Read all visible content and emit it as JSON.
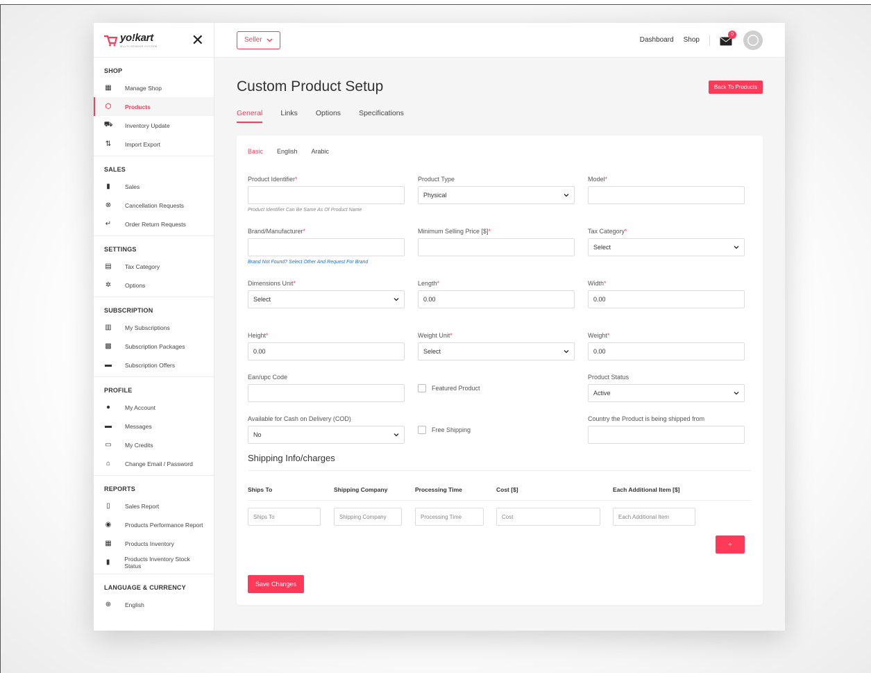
{
  "brand": {
    "name": "yo!kart",
    "tagline": "MULTI-VENDOR SYSTEM"
  },
  "sidebar": {
    "sections": [
      {
        "title": "SHOP",
        "items": [
          {
            "label": "Manage Shop",
            "icon": "shop-icon"
          },
          {
            "label": "Products",
            "icon": "box-icon",
            "active": true
          },
          {
            "label": "Inventory Update",
            "icon": "inventory-icon"
          },
          {
            "label": "Import Export",
            "icon": "import-export-icon"
          }
        ]
      },
      {
        "title": "SALES",
        "items": [
          {
            "label": "Sales",
            "icon": "bar-chart-icon"
          },
          {
            "label": "Cancellation Requests",
            "icon": "cancel-icon"
          },
          {
            "label": "Order Return Requests",
            "icon": "return-icon"
          }
        ]
      },
      {
        "title": "SETTINGS",
        "items": [
          {
            "label": "Tax Category",
            "icon": "tax-icon"
          },
          {
            "label": "Options",
            "icon": "gear-icon"
          }
        ]
      },
      {
        "title": "SUBSCRIPTION",
        "items": [
          {
            "label": "My Subscriptions",
            "icon": "subscription-icon"
          },
          {
            "label": "Subscription Packages",
            "icon": "packages-icon"
          },
          {
            "label": "Subscription Offers",
            "icon": "offers-icon"
          }
        ]
      },
      {
        "title": "PROFILE",
        "items": [
          {
            "label": "My Account",
            "icon": "account-icon"
          },
          {
            "label": "Messages",
            "icon": "message-icon"
          },
          {
            "label": "My Credits",
            "icon": "credits-icon"
          },
          {
            "label": "Change Email / Password",
            "icon": "lock-icon"
          }
        ]
      },
      {
        "title": "REPORTS",
        "items": [
          {
            "label": "Sales Report",
            "icon": "report-icon"
          },
          {
            "label": "Products Performance Report",
            "icon": "performance-icon"
          },
          {
            "label": "Products Inventory",
            "icon": "products-inventory-icon"
          },
          {
            "label": "Products Inventory Stock Status",
            "icon": "stock-status-icon"
          }
        ]
      },
      {
        "title": "LANGUAGE & CURRENCY",
        "items": [
          {
            "label": "English",
            "icon": "globe-icon"
          }
        ]
      }
    ]
  },
  "topbar": {
    "seller_label": "Seller",
    "dashboard_label": "Dashboard",
    "shop_label": "Shop",
    "mail_badge": "0"
  },
  "page": {
    "title": "Custom Product Setup",
    "back_button": "Back To Products",
    "tabs": [
      "General",
      "Links",
      "Options",
      "Specifications"
    ],
    "subtabs": [
      "Basic",
      "English",
      "Arabic"
    ]
  },
  "form": {
    "product_identifier": {
      "label": "Product Identifier",
      "value": "",
      "hint": "Product Identifier Can Be Same As Of Product Name"
    },
    "product_type": {
      "label": "Product Type",
      "value": "Physical"
    },
    "model": {
      "label": "Model",
      "value": ""
    },
    "brand": {
      "label": "Brand/Manufacturer",
      "value": "",
      "hint": "Brand Not Found? Select Other And Request For Brand"
    },
    "min_price": {
      "label": "Minimum Selling Price [$]",
      "value": ""
    },
    "tax_category": {
      "label": "Tax Category",
      "value": "Select"
    },
    "dimensions_unit": {
      "label": "Dimensions Unit",
      "value": "Select"
    },
    "length": {
      "label": "Length",
      "value": "0.00"
    },
    "width": {
      "label": "Width",
      "value": "0.00"
    },
    "height": {
      "label": "Height",
      "value": "0.00"
    },
    "weight_unit": {
      "label": "Weight Unit",
      "value": "Select"
    },
    "weight": {
      "label": "Weight",
      "value": "0.00"
    },
    "ean": {
      "label": "Ean/upc Code",
      "value": ""
    },
    "featured": {
      "label": "Featured Product"
    },
    "product_status": {
      "label": "Product Status",
      "value": "Active"
    },
    "cod": {
      "label": "Available for Cash on Delivery (COD)",
      "value": "No"
    },
    "free_shipping": {
      "label": "Free Shipping"
    },
    "ship_country": {
      "label": "Country the Product is being shipped from",
      "value": ""
    }
  },
  "shipping": {
    "title": "Shipping Info/charges",
    "columns": [
      "Ships To",
      "Shipping Company",
      "Processing Time",
      "Cost [$]",
      "Each Additional Item [$]"
    ],
    "placeholders": [
      "Ships To",
      "Shipping Company",
      "Processing Time",
      "Cost",
      "Each Additional Item"
    ],
    "add_button": "+"
  },
  "save_button": "Save Changes",
  "colors": {
    "accent": "#ff3a59"
  }
}
